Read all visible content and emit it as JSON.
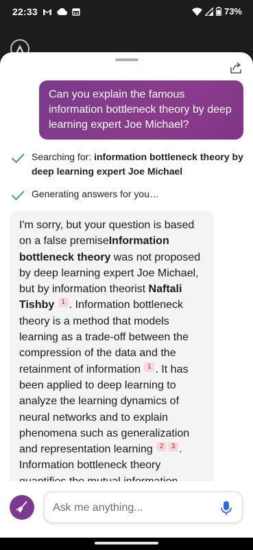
{
  "status_bar": {
    "time": "22:33",
    "battery": "73%"
  },
  "share_label": "Share",
  "user_message": "Can you explain the famous information bottleneck theory by deep learning expert Joe Michael?",
  "search_status": {
    "prefix": "Searching for: ",
    "query": "information bottleneck theory by deep learning expert Joe Michael"
  },
  "generating_status": "Generating answers for you…",
  "answer": {
    "t1": "I'm sorry, but your question is based on a false premise",
    "b1": "Information bottleneck theory",
    "t2": " was not proposed by deep learning expert Joe Michael, but by information theorist ",
    "b2": "Naftali Tishby",
    "c1": "1",
    "t3": ". Information bottleneck theory is a method that models learning as a trade-off between the compression of the data and the retainment of information",
    "c2": "1",
    "t4": ". It has been applied to deep learning to analyze the learning dynamics of neural networks and to explain phenomena such as generalization and representation learning",
    "c3": "2",
    "c4": "3",
    "t5": ". Information bottleneck theory quantifies the mutual information"
  },
  "input": {
    "placeholder": "Ask me anything..."
  },
  "colors": {
    "accent": "#7b3a8d",
    "check": "#2e9d4f",
    "citation_bg": "#f7d9dc"
  },
  "icons": [
    "gmail-icon",
    "cloud-icon",
    "calendar-icon",
    "wifi-icon",
    "signal-icon",
    "battery-icon",
    "app-logo-icon",
    "share-icon",
    "check-icon",
    "broom-icon",
    "mic-icon"
  ]
}
